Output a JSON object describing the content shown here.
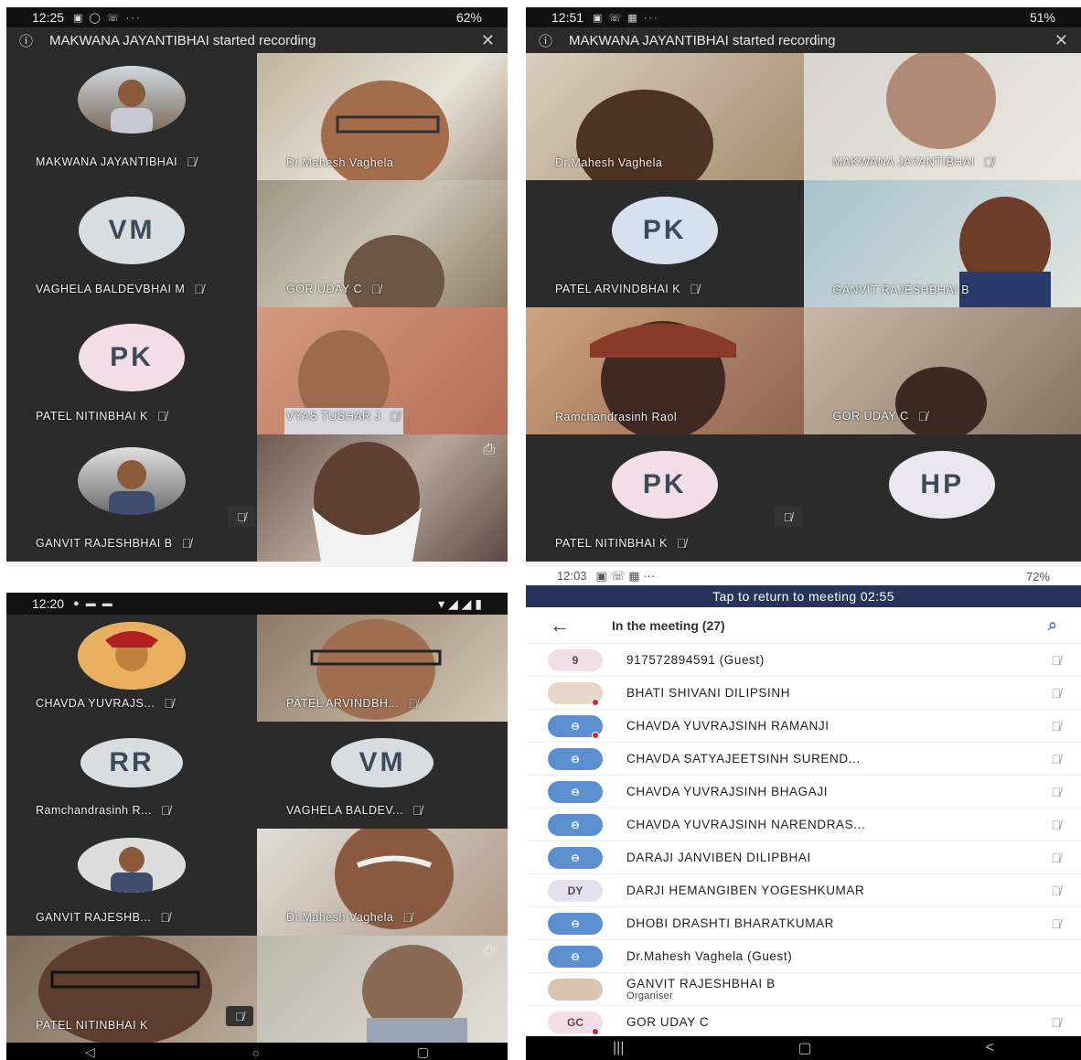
{
  "s1": {
    "time": "12:25",
    "status_icons": "▣ ◯ ☏ ···",
    "battery": "62%",
    "banner": "MAKWANA JAYANTIBHAI started recording",
    "tiles": [
      {
        "name": "MAKWANA JAYANTIBHAI"
      },
      {
        "name": "Dr.Mahesh Vaghela"
      },
      {
        "name": "VAGHELA BALDEVBHAI M",
        "initials": "VM"
      },
      {
        "name": "GOR UDAY C"
      },
      {
        "name": "PATEL NITINBHAI K",
        "initials": "PK"
      },
      {
        "name": "VYAS TUSHAR J"
      },
      {
        "name": "GANVIT RAJESHBHAI B"
      },
      {
        "name": ""
      }
    ]
  },
  "s2": {
    "time": "12:51",
    "status_icons": "▣ ☏ ▦ ···",
    "battery": "51%",
    "banner": "MAKWANA JAYANTIBHAI started recording",
    "tiles": [
      {
        "name": "Dr.Mahesh Vaghela"
      },
      {
        "name": "MAKWANA JAYANTIBHAI"
      },
      {
        "name": "PATEL ARVINDBHAI K",
        "initials": "PK"
      },
      {
        "name": "GANVIT RAJESHBHAI B"
      },
      {
        "name": "Ramchandrasinh Raol"
      },
      {
        "name": "GOR UDAY C"
      },
      {
        "name": "PATEL NITINBHAI K",
        "initials": "PK"
      },
      {
        "name": "",
        "initials": "HP"
      }
    ]
  },
  "s3": {
    "time": "12:20",
    "status_icons": "● ▬ ▬",
    "tiles": [
      {
        "name": "CHAVDA YUVRAJS..."
      },
      {
        "name": "PATEL ARVINDBH..."
      },
      {
        "name": "Ramchandrasinh R...",
        "initials": "RR"
      },
      {
        "name": "VAGHELA BALDEV...",
        "initials": "VM"
      },
      {
        "name": "GANVIT RAJESHB..."
      },
      {
        "name": "Dr.Mahesh Vaghela"
      },
      {
        "name": "PATEL NITINBHAI K"
      },
      {
        "name": ""
      }
    ]
  },
  "s4": {
    "time": "12:03",
    "status_icons": "▣ ☏ ▦ ···",
    "battery": "72%",
    "return_text": "Tap to return to meeting 02:55",
    "list_title": "In the meeting (27)",
    "participants": [
      {
        "avatar": "9",
        "name": "917572894591 (Guest)"
      },
      {
        "avatar": "",
        "name": "BHATI SHIVANI DILIPSINH"
      },
      {
        "avatar": "",
        "name": "CHAVDA  YUVRAJSINH RAMANJI"
      },
      {
        "avatar": "",
        "name": "CHAVDA SATYAJEETSINH SUREND..."
      },
      {
        "avatar": "",
        "name": "CHAVDA YUVRAJSINH BHAGAJI"
      },
      {
        "avatar": "",
        "name": "CHAVDA YUVRAJSINH NARENDRAS..."
      },
      {
        "avatar": "",
        "name": "DARAJI JANVIBEN DILIPBHAI"
      },
      {
        "avatar": "DY",
        "name": "DARJI HEMANGIBEN YOGESHKUMAR"
      },
      {
        "avatar": "",
        "name": "DHOBI  DRASHTI BHARATKUMAR"
      },
      {
        "avatar": "",
        "name": "Dr.Mahesh Vaghela (Guest)"
      },
      {
        "avatar": "",
        "name": "GANVIT RAJESHBHAI B",
        "role": "Organiser"
      },
      {
        "avatar": "GC",
        "name": "GOR UDAY C"
      }
    ]
  },
  "colors": {
    "return_bar": "#26345c",
    "avatar_blue": "#d6e0ee",
    "avatar_pink": "#f3dde6",
    "avatar_gray": "#d8dde2",
    "user_icon_blue": "#5b8fd0"
  }
}
